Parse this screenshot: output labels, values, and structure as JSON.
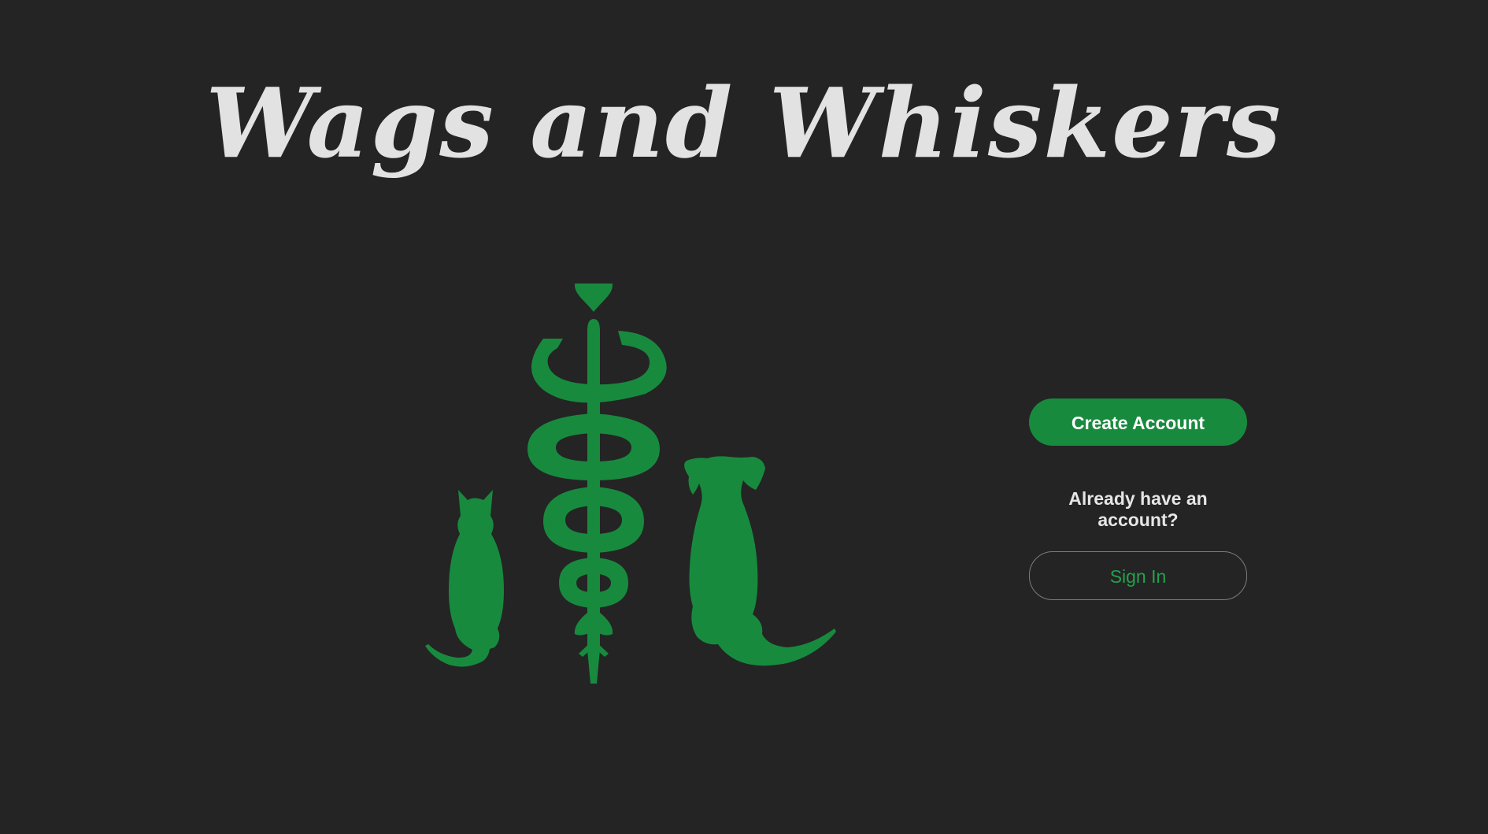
{
  "header": {
    "title": "Wags and Whiskers"
  },
  "logo": {
    "icon": "vet-caduceus-cat-dog-logo",
    "color": "#188a3e"
  },
  "auth": {
    "create_account_label": "Create Account",
    "signin_prompt": "Already have an account?",
    "signin_label": "Sign In"
  },
  "colors": {
    "background": "#242424",
    "accent": "#188a3e",
    "title_text": "#e2e2e2",
    "signin_text": "#23a24d"
  }
}
